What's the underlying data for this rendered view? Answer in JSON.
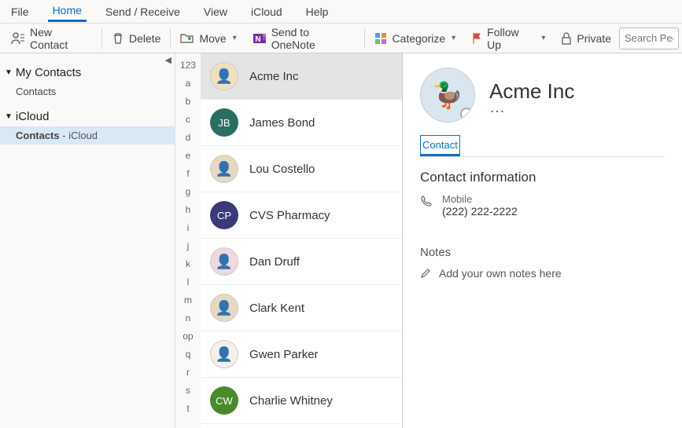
{
  "tabs": {
    "file": "File",
    "home": "Home",
    "sendrecv": "Send / Receive",
    "view": "View",
    "icloud": "iCloud",
    "help": "Help"
  },
  "toolbar": {
    "new_contact": "New Contact",
    "delete": "Delete",
    "move": "Move",
    "onenote": "Send to OneNote",
    "categorize": "Categorize",
    "followup": "Follow Up",
    "private": "Private",
    "search_placeholder": "Search Peopl"
  },
  "sidebar": {
    "groups": [
      {
        "title": "My Contacts",
        "items": [
          {
            "label": "Contacts",
            "suffix": "",
            "selected": false
          }
        ]
      },
      {
        "title": "iCloud",
        "items": [
          {
            "label": "Contacts",
            "suffix": " - iCloud",
            "selected": true
          }
        ]
      }
    ]
  },
  "az": [
    "123",
    "a",
    "b",
    "c",
    "d",
    "e",
    "f",
    "g",
    "h",
    "i",
    "j",
    "k",
    "l",
    "m",
    "n",
    "op",
    "q",
    "r",
    "s",
    "t"
  ],
  "contacts": [
    {
      "name": "Acme Inc",
      "initials": "",
      "color": "#f0e0c0",
      "img": true,
      "selected": true
    },
    {
      "name": "James Bond",
      "initials": "JB",
      "color": "#2a6e63",
      "img": false
    },
    {
      "name": "Lou Costello",
      "initials": "",
      "color": "#e8d8c0",
      "img": true
    },
    {
      "name": "CVS Pharmacy",
      "initials": "CP",
      "color": "#3b3a78",
      "img": false
    },
    {
      "name": "Dan Druff",
      "initials": "",
      "color": "#f0d8e0",
      "img": true
    },
    {
      "name": "Clark Kent",
      "initials": "",
      "color": "#e8d8c0",
      "img": true
    },
    {
      "name": "Gwen Parker",
      "initials": "",
      "color": "#f5f0e8",
      "img": true
    },
    {
      "name": "Charlie Whitney",
      "initials": "CW",
      "color": "#4a8a2a",
      "img": false
    }
  ],
  "detail": {
    "name": "Acme Inc",
    "subtitle": "…",
    "tab": "Contact",
    "section": "Contact information",
    "phone_label": "Mobile",
    "phone_value": "(222) 222-2222",
    "notes_label": "Notes",
    "notes_placeholder": "Add your own notes here"
  }
}
